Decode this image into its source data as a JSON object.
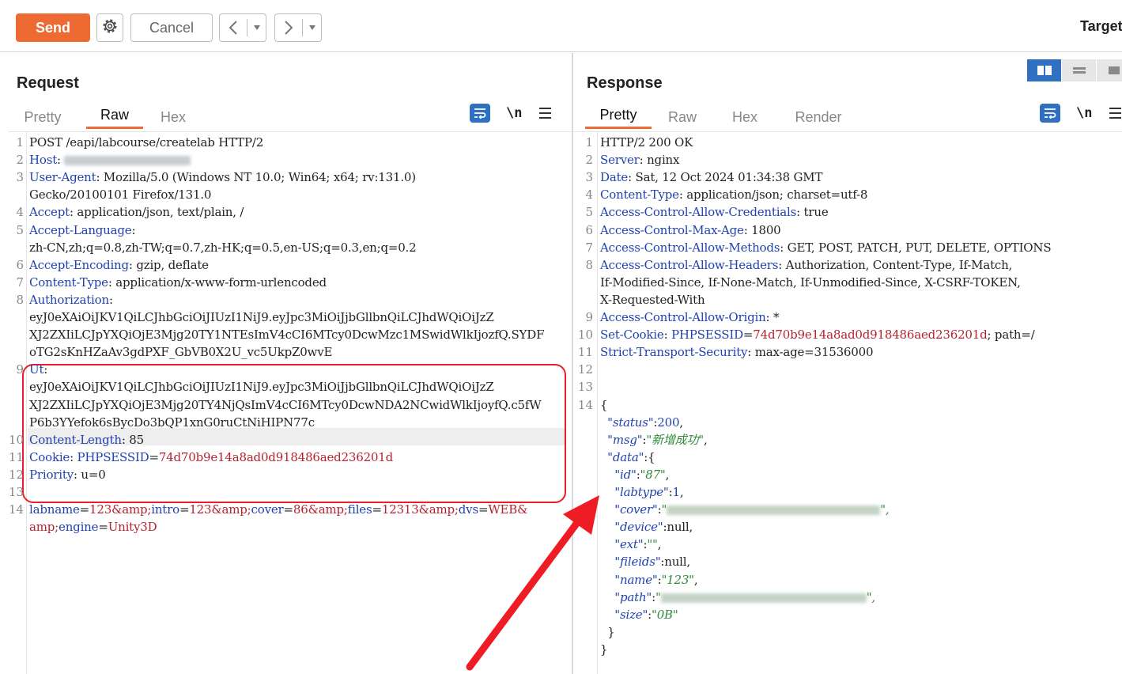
{
  "toolbar": {
    "send_label": "Send",
    "cancel_label": "Cancel",
    "target_label": "Target"
  },
  "colors": {
    "accent": "#ee6a33",
    "header_name": "#2042b0",
    "highlight_value": "#b5232f",
    "json_string": "#2e8a3a",
    "box_red": "#e5202b",
    "toggle_active": "#2f70c3"
  },
  "request": {
    "title": "Request",
    "tabs": [
      "Pretty",
      "Raw",
      "Hex"
    ],
    "active_tab": "Raw",
    "lines": [
      {
        "n": "1",
        "segs": [
          {
            "t": "POST /eapi/labcourse/createlab HTTP/2",
            "c": "v"
          }
        ]
      },
      {
        "n": "2",
        "segs": [
          {
            "t": "Host",
            "c": "k"
          },
          {
            "t": ": ",
            "c": "v"
          }
        ],
        "blur": "gray"
      },
      {
        "n": "3",
        "segs": [
          {
            "t": "User-Agent",
            "c": "k"
          },
          {
            "t": ": Mozilla/5.0 (Windows NT 10.0; Win64; x64; rv:131.0)",
            "c": "v"
          }
        ]
      },
      {
        "n": "",
        "segs": [
          {
            "t": "Gecko/20100101 Firefox/131.0",
            "c": "v"
          }
        ]
      },
      {
        "n": "4",
        "segs": [
          {
            "t": "Accept",
            "c": "k"
          },
          {
            "t": ": application/json, text/plain, /",
            "c": "v"
          }
        ]
      },
      {
        "n": "5",
        "segs": [
          {
            "t": "Accept-Language",
            "c": "k"
          },
          {
            "t": ":",
            "c": "v"
          }
        ]
      },
      {
        "n": "",
        "segs": [
          {
            "t": "zh-CN,zh;q=0.8,zh-TW;q=0.7,zh-HK;q=0.5,en-US;q=0.3,en;q=0.2",
            "c": "v"
          }
        ]
      },
      {
        "n": "6",
        "segs": [
          {
            "t": "Accept-Encoding",
            "c": "k"
          },
          {
            "t": ": gzip, deflate",
            "c": "v"
          }
        ]
      },
      {
        "n": "7",
        "segs": [
          {
            "t": "Content-Type",
            "c": "k"
          },
          {
            "t": ": application/x-www-form-urlencoded",
            "c": "v"
          }
        ]
      },
      {
        "n": "8",
        "segs": [
          {
            "t": "Authorization",
            "c": "k"
          },
          {
            "t": ":",
            "c": "v"
          }
        ]
      },
      {
        "n": "",
        "segs": [
          {
            "t": "eyJ0eXAiOiJKV1QiLCJhbGciOiJIUzI1NiJ9.eyJpc3MiOiJjbGllbnQiLCJhdWQiOiJzZ",
            "c": "v"
          }
        ]
      },
      {
        "n": "",
        "segs": [
          {
            "t": "XJ2ZXIiLCJpYXQiOjE3Mjg20TY1NTEsImV4cCI6MTcy0DcwMzc1MSwidWlkIjozfQ.SYDF",
            "c": "v"
          }
        ]
      },
      {
        "n": "",
        "segs": [
          {
            "t": "oTG2sKnHZaAv3gdPXF_GbVB0X2U_vc5UkpZ0wvE",
            "c": "v"
          }
        ]
      },
      {
        "n": "9",
        "segs": [
          {
            "t": "Ut",
            "c": "k"
          },
          {
            "t": ":",
            "c": "v"
          }
        ]
      },
      {
        "n": "",
        "segs": [
          {
            "t": "eyJ0eXAiOiJKV1QiLCJhbGciOiJIUzI1NiJ9.eyJpc3MiOiJjbGllbnQiLCJhdWQiOiJzZ",
            "c": "v"
          }
        ]
      },
      {
        "n": "",
        "segs": [
          {
            "t": "XJ2ZXIiLCJpYXQiOjE3Mjg20TY4NjQsImV4cCI6MTcy0DcwNDA2NCwidWlkIjoyfQ.c5fW",
            "c": "v"
          }
        ]
      },
      {
        "n": "",
        "segs": [
          {
            "t": "P6b3YYefok6sBycDo3bQP1xnG0ruCtNiHIPN77c",
            "c": "v"
          }
        ]
      },
      {
        "n": "10",
        "segs": [
          {
            "t": "Content-Length",
            "c": "k"
          },
          {
            "t": ": 85",
            "c": "v"
          }
        ]
      },
      {
        "n": "11",
        "segs": [
          {
            "t": "Cookie",
            "c": "k"
          },
          {
            "t": ": ",
            "c": "v"
          },
          {
            "t": "PHPSESSID",
            "c": "k"
          },
          {
            "t": "=",
            "c": "v"
          },
          {
            "t": "74d70b9e14a8ad0d918486aed236201d",
            "c": "r"
          }
        ]
      },
      {
        "n": "12",
        "segs": [
          {
            "t": "Priority",
            "c": "k"
          },
          {
            "t": ": u=0",
            "c": "v"
          }
        ]
      },
      {
        "n": "13",
        "segs": []
      },
      {
        "n": "14",
        "segs": [
          {
            "t": "labname",
            "c": "k"
          },
          {
            "t": "=",
            "c": "v"
          },
          {
            "t": "123",
            "c": "r"
          },
          {
            "t": "&amp;",
            "c": "r"
          },
          {
            "t": "intro",
            "c": "k"
          },
          {
            "t": "=",
            "c": "v"
          },
          {
            "t": "123",
            "c": "r"
          },
          {
            "t": "&amp;",
            "c": "r"
          },
          {
            "t": "cover",
            "c": "k"
          },
          {
            "t": "=",
            "c": "v"
          },
          {
            "t": "86",
            "c": "r"
          },
          {
            "t": "&amp;",
            "c": "r"
          },
          {
            "t": "files",
            "c": "k"
          },
          {
            "t": "=",
            "c": "v"
          },
          {
            "t": "12313",
            "c": "r"
          },
          {
            "t": "&amp;",
            "c": "r"
          },
          {
            "t": "dvs",
            "c": "k"
          },
          {
            "t": "=",
            "c": "v"
          },
          {
            "t": "WEB",
            "c": "r"
          },
          {
            "t": "&",
            "c": "r"
          }
        ]
      },
      {
        "n": "",
        "segs": [
          {
            "t": "amp;",
            "c": "r"
          },
          {
            "t": "engine",
            "c": "k"
          },
          {
            "t": "=",
            "c": "v"
          },
          {
            "t": "Unity3D",
            "c": "r"
          }
        ]
      }
    ]
  },
  "response": {
    "title": "Response",
    "tabs": [
      "Pretty",
      "Raw",
      "Hex",
      "Render"
    ],
    "active_tab": "Pretty",
    "lines": [
      {
        "n": "1",
        "segs": [
          {
            "t": "HTTP/2 200 OK",
            "c": "v"
          }
        ]
      },
      {
        "n": "2",
        "segs": [
          {
            "t": "Server",
            "c": "k"
          },
          {
            "t": ": nginx",
            "c": "v"
          }
        ]
      },
      {
        "n": "3",
        "segs": [
          {
            "t": "Date",
            "c": "k"
          },
          {
            "t": ": Sat, 12 Oct 2024 01:34:38 GMT",
            "c": "v"
          }
        ]
      },
      {
        "n": "4",
        "segs": [
          {
            "t": "Content-Type",
            "c": "k"
          },
          {
            "t": ": application/json; charset=utf-8",
            "c": "v"
          }
        ]
      },
      {
        "n": "5",
        "segs": [
          {
            "t": "Access-Control-Allow-Credentials",
            "c": "k"
          },
          {
            "t": ": true",
            "c": "v"
          }
        ]
      },
      {
        "n": "6",
        "segs": [
          {
            "t": "Access-Control-Max-Age",
            "c": "k"
          },
          {
            "t": ": 1800",
            "c": "v"
          }
        ]
      },
      {
        "n": "7",
        "segs": [
          {
            "t": "Access-Control-Allow-Methods",
            "c": "k"
          },
          {
            "t": ": GET, POST, PATCH, PUT, DELETE, OPTIONS",
            "c": "v"
          }
        ]
      },
      {
        "n": "8",
        "segs": [
          {
            "t": "Access-Control-Allow-Headers",
            "c": "k"
          },
          {
            "t": ": Authorization, Content-Type, If-Match,",
            "c": "v"
          }
        ]
      },
      {
        "n": "",
        "segs": [
          {
            "t": "If-Modified-Since, If-None-Match, If-Unmodified-Since, X-CSRF-TOKEN,",
            "c": "v"
          }
        ]
      },
      {
        "n": "",
        "segs": [
          {
            "t": "X-Requested-With",
            "c": "v"
          }
        ]
      },
      {
        "n": "9",
        "segs": [
          {
            "t": "Access-Control-Allow-Origin",
            "c": "k"
          },
          {
            "t": ": *",
            "c": "v"
          }
        ]
      },
      {
        "n": "10",
        "segs": [
          {
            "t": "Set-Cookie",
            "c": "k"
          },
          {
            "t": ": ",
            "c": "v"
          },
          {
            "t": "PHPSESSID",
            "c": "k"
          },
          {
            "t": "=",
            "c": "v"
          },
          {
            "t": "74d70b9e14a8ad0d918486aed236201d",
            "c": "r"
          },
          {
            "t": "; path=/",
            "c": "v"
          }
        ]
      },
      {
        "n": "11",
        "segs": [
          {
            "t": "Strict-Transport-Security",
            "c": "k"
          },
          {
            "t": ": max-age=31536000",
            "c": "v"
          }
        ]
      },
      {
        "n": "12",
        "segs": []
      },
      {
        "n": "13",
        "segs": []
      },
      {
        "n": "14",
        "segs": [
          {
            "t": "{",
            "c": "v"
          }
        ]
      },
      {
        "n": "",
        "segs": [
          {
            "t": "  ",
            "c": "v"
          },
          {
            "t": "\"status\"",
            "c": "jk"
          },
          {
            "t": ":",
            "c": "v"
          },
          {
            "t": "200",
            "c": "jn"
          },
          {
            "t": ",",
            "c": "v"
          }
        ]
      },
      {
        "n": "",
        "segs": [
          {
            "t": "  ",
            "c": "v"
          },
          {
            "t": "\"msg\"",
            "c": "jk"
          },
          {
            "t": ":",
            "c": "v"
          },
          {
            "t": "\"新增成功\"",
            "c": "jv"
          },
          {
            "t": ",",
            "c": "v"
          }
        ]
      },
      {
        "n": "",
        "segs": [
          {
            "t": "  ",
            "c": "v"
          },
          {
            "t": "\"data\"",
            "c": "jk"
          },
          {
            "t": ":{",
            "c": "v"
          }
        ]
      },
      {
        "n": "",
        "segs": [
          {
            "t": "    ",
            "c": "v"
          },
          {
            "t": "\"id\"",
            "c": "jk"
          },
          {
            "t": ":",
            "c": "v"
          },
          {
            "t": "\"87\"",
            "c": "jv"
          },
          {
            "t": ",",
            "c": "v"
          }
        ]
      },
      {
        "n": "",
        "segs": [
          {
            "t": "    ",
            "c": "v"
          },
          {
            "t": "\"labtype\"",
            "c": "jk"
          },
          {
            "t": ":",
            "c": "v"
          },
          {
            "t": "1",
            "c": "jn"
          },
          {
            "t": ",",
            "c": "v"
          }
        ]
      },
      {
        "n": "",
        "segs": [
          {
            "t": "    ",
            "c": "v"
          },
          {
            "t": "\"cover\"",
            "c": "jk"
          },
          {
            "t": ":",
            "c": "v"
          },
          {
            "t": "\"",
            "c": "jv"
          }
        ],
        "blur": "green",
        "after": [
          {
            "t": "\",",
            "c": "jv"
          }
        ]
      },
      {
        "n": "",
        "segs": [
          {
            "t": "    ",
            "c": "v"
          },
          {
            "t": "\"device\"",
            "c": "jk"
          },
          {
            "t": ":null,",
            "c": "v"
          }
        ]
      },
      {
        "n": "",
        "segs": [
          {
            "t": "    ",
            "c": "v"
          },
          {
            "t": "\"ext\"",
            "c": "jk"
          },
          {
            "t": ":",
            "c": "v"
          },
          {
            "t": "\"\"",
            "c": "jv"
          },
          {
            "t": ",",
            "c": "v"
          }
        ]
      },
      {
        "n": "",
        "segs": [
          {
            "t": "    ",
            "c": "v"
          },
          {
            "t": "\"fileids\"",
            "c": "jk"
          },
          {
            "t": ":null,",
            "c": "v"
          }
        ]
      },
      {
        "n": "",
        "segs": [
          {
            "t": "    ",
            "c": "v"
          },
          {
            "t": "\"name\"",
            "c": "jk"
          },
          {
            "t": ":",
            "c": "v"
          },
          {
            "t": "\"123\"",
            "c": "jv"
          },
          {
            "t": ",",
            "c": "v"
          }
        ]
      },
      {
        "n": "",
        "segs": [
          {
            "t": "    ",
            "c": "v"
          },
          {
            "t": "\"path\"",
            "c": "jk"
          },
          {
            "t": ":",
            "c": "v"
          },
          {
            "t": "\"",
            "c": "jv"
          }
        ],
        "blur": "green",
        "after": [
          {
            "t": "\",",
            "c": "jv"
          }
        ]
      },
      {
        "n": "",
        "segs": [
          {
            "t": "    ",
            "c": "v"
          },
          {
            "t": "\"size\"",
            "c": "jk"
          },
          {
            "t": ":",
            "c": "v"
          },
          {
            "t": "\"0B\"",
            "c": "jv"
          }
        ]
      },
      {
        "n": "",
        "segs": [
          {
            "t": "  }",
            "c": "v"
          }
        ]
      },
      {
        "n": "",
        "segs": [
          {
            "t": "}",
            "c": "v"
          }
        ]
      }
    ]
  }
}
